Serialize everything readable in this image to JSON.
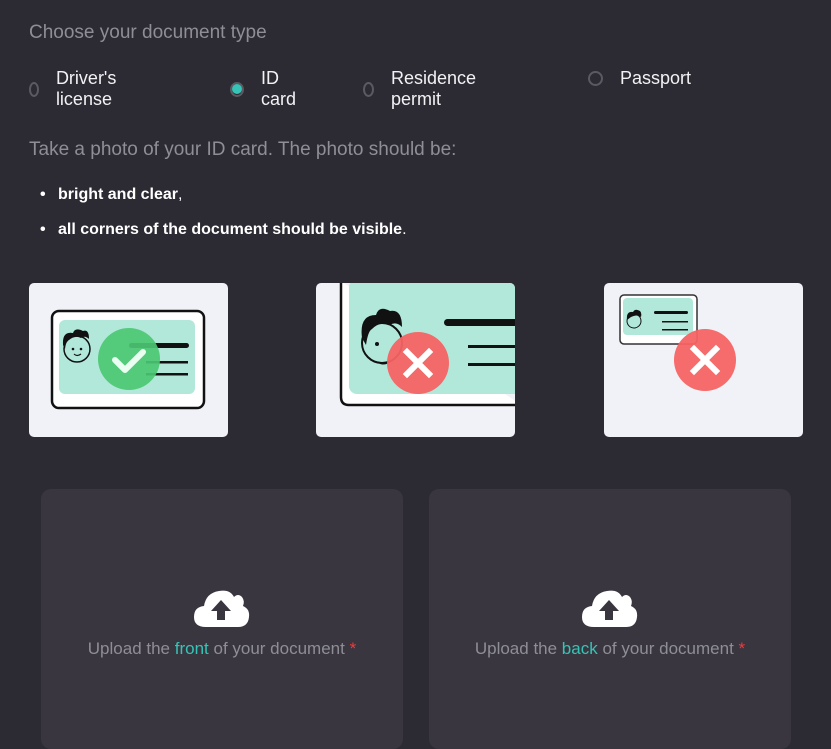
{
  "document_type": {
    "title": "Choose your document type",
    "options": [
      {
        "label": "Driver's license",
        "selected": false
      },
      {
        "label": "ID card",
        "selected": true
      },
      {
        "label": "Residence permit",
        "selected": false
      },
      {
        "label": "Passport",
        "selected": false
      }
    ]
  },
  "instructions": {
    "intro": "Take a photo of your ID card. The photo should be:",
    "requirements": [
      {
        "text": "bright and clear",
        "suffix": ","
      },
      {
        "text": "all corners of the document should be visible",
        "suffix": "."
      }
    ]
  },
  "examples": [
    {
      "kind": "correct",
      "icon": "check-icon"
    },
    {
      "kind": "cropped",
      "icon": "cross-icon"
    },
    {
      "kind": "too-small",
      "icon": "cross-icon"
    }
  ],
  "uploads": [
    {
      "prefix": "Upload the ",
      "highlight": "front",
      "suffix": " of your document",
      "required_mark": "*"
    },
    {
      "prefix": "Upload the ",
      "highlight": "back",
      "suffix": " of your document",
      "required_mark": "*"
    }
  ],
  "colors": {
    "accent": "#35c4b5",
    "background": "#2c2a33",
    "panel": "#393640",
    "success": "#4cc773",
    "error": "#f56363",
    "required": "#ee3b3b"
  }
}
